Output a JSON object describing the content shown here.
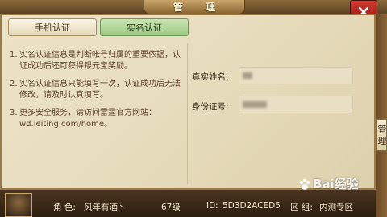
{
  "window": {
    "title": "管 理"
  },
  "tabs": [
    {
      "label": "手机认证",
      "active": false
    },
    {
      "label": "实名认证",
      "active": true
    }
  ],
  "notes": [
    {
      "num": "1.",
      "text": "实名认证信息是判断帐号归属的重要依据，认证成功后还可获得银元宝奖励。"
    },
    {
      "num": "2.",
      "text": "实名认证信息只能填写一次，认证成功后无法修改，请及时认真填写。"
    },
    {
      "num": "3.",
      "text": "更多安全服务，请访问雷霆官方网站：wd.leiting.com/home。"
    }
  ],
  "form": {
    "real_name_label": "真实姓名:",
    "id_number_label": "身份证号:"
  },
  "side_tab": {
    "label": "管 理"
  },
  "footer": {
    "role_label": "角 色:",
    "role_value": "风年有酒丶",
    "level": "67级",
    "id_label": "ID:",
    "id_value": "5D3D2ACED5",
    "zone_label": "区 组:",
    "zone_value": "内测专区"
  },
  "watermark": {
    "text": "Bai经验"
  },
  "colors": {
    "accent": "#9cc984",
    "panel": "#ece3c8",
    "frame": "#9b7a45"
  },
  "icons": {
    "close": "close-icon",
    "paw": "baidu-paw-icon"
  }
}
